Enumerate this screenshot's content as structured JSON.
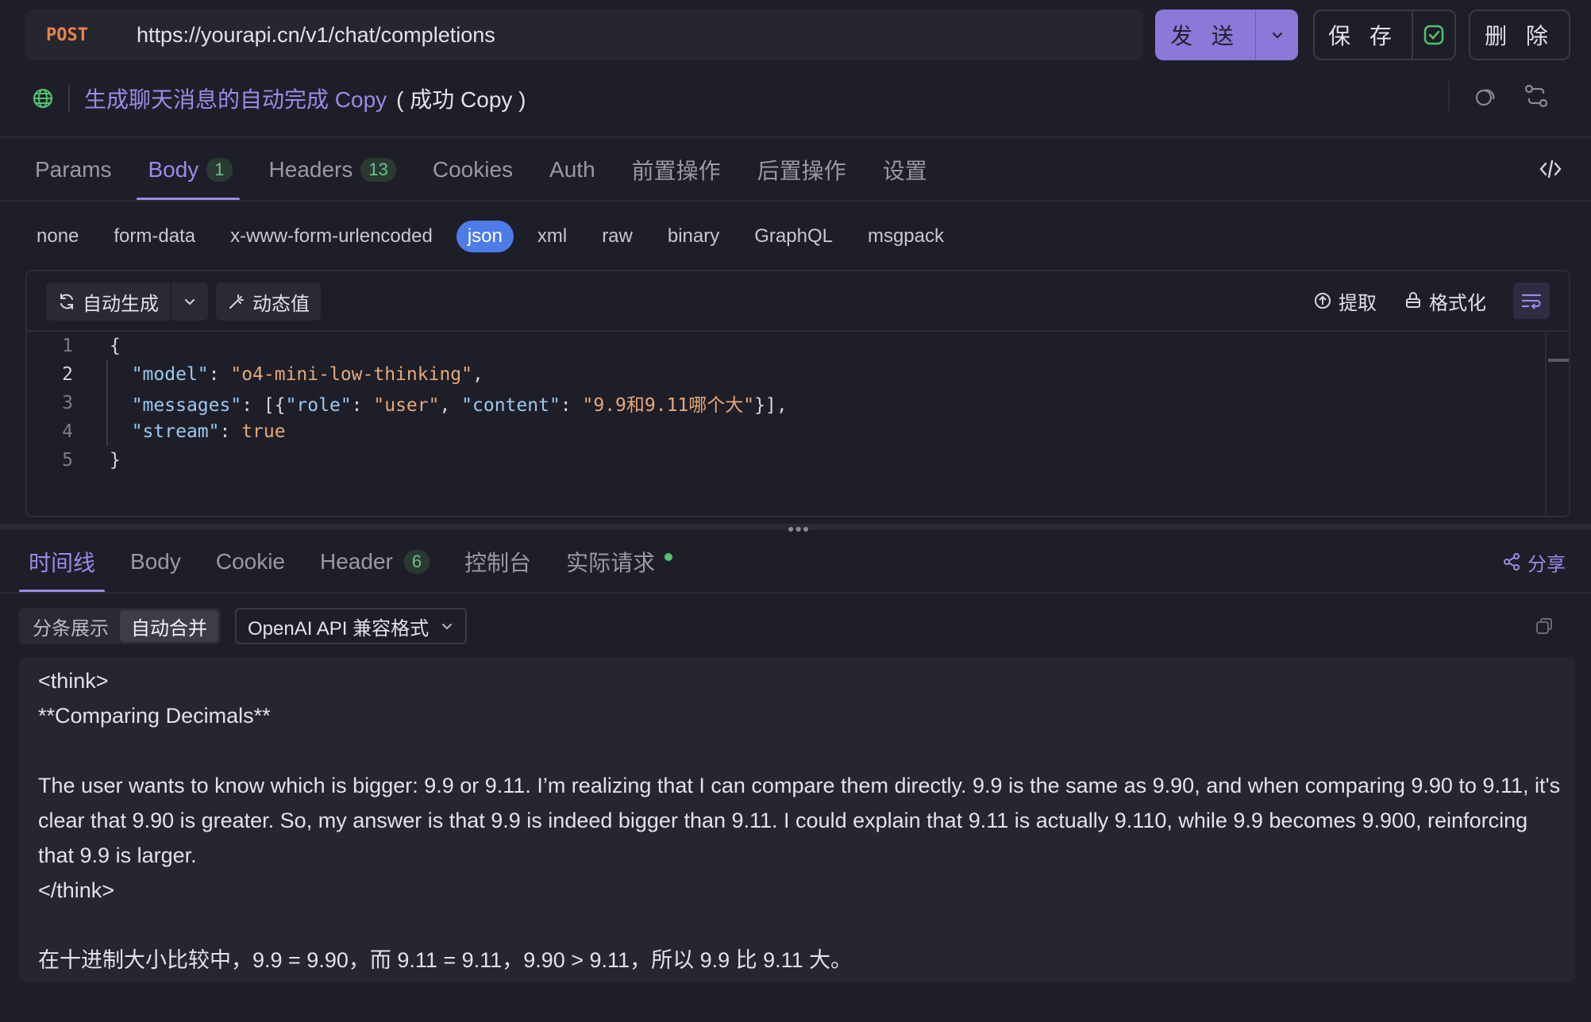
{
  "request": {
    "method": "POST",
    "url": "https://yourapi.cn/v1/chat/completions",
    "send_label": "发 送",
    "save_label": "保 存",
    "delete_label": "删 除"
  },
  "title": {
    "name": "生成聊天消息的自动完成 Copy",
    "status": "( 成功 Copy )"
  },
  "request_tabs": [
    {
      "label": "Params",
      "badge": ""
    },
    {
      "label": "Body",
      "badge": "1"
    },
    {
      "label": "Headers",
      "badge": "13"
    },
    {
      "label": "Cookies",
      "badge": ""
    },
    {
      "label": "Auth",
      "badge": ""
    },
    {
      "label": "前置操作",
      "badge": ""
    },
    {
      "label": "后置操作",
      "badge": ""
    },
    {
      "label": "设置",
      "badge": ""
    }
  ],
  "body_types": [
    "none",
    "form-data",
    "x-www-form-urlencoded",
    "json",
    "xml",
    "raw",
    "binary",
    "GraphQL",
    "msgpack"
  ],
  "editor_toolbar": {
    "auto_generate": "自动生成",
    "dynamic_value": "动态值",
    "extract": "提取",
    "format": "格式化"
  },
  "code": {
    "line_numbers": [
      "1",
      "2",
      "3",
      "4",
      "5"
    ],
    "open": "{",
    "close": "}",
    "model_key": "\"model\"",
    "model_val": "\"o4-mini-low-thinking\"",
    "messages_key": "\"messages\"",
    "role_key": "\"role\"",
    "role_val": "\"user\"",
    "content_key": "\"content\"",
    "content_val": "\"9.9和9.11哪个大\"",
    "stream_key": "\"stream\"",
    "stream_val": "true"
  },
  "response_tabs": [
    {
      "label": "时间线",
      "badge": ""
    },
    {
      "label": "Body",
      "badge": ""
    },
    {
      "label": "Cookie",
      "badge": ""
    },
    {
      "label": "Header",
      "badge": "6"
    },
    {
      "label": "控制台",
      "badge": ""
    },
    {
      "label": "实际请求",
      "badge": ""
    }
  ],
  "share_label": "分享",
  "display_modes": [
    "分条展示",
    "自动合并"
  ],
  "format_select": "OpenAI API 兼容格式",
  "response_lines": [
    "<think>",
    "**Comparing Decimals**",
    "",
    "The user wants to know which is bigger: 9.9 or 9.11. I’m realizing that I can compare them directly. 9.9 is the same as 9.90, and when comparing 9.90 to 9.11, it's clear that 9.90 is greater. So, my answer is that 9.9 is indeed bigger than 9.11. I could explain that 9.11 is actually 9.110, while 9.9 becomes 9.900, reinforcing that 9.9 is larger.",
    "</think>",
    "",
    "在十进制大小比较中，9.9 = 9.90，而 9.11 = 9.11，9.90 > 9.11，所以 9.9 比 9.11 大。"
  ],
  "colors": {
    "accent": "#9b8ae6",
    "method": "#e8834a",
    "active_body_type": "#4d7ce8",
    "success": "#4fc36e"
  }
}
